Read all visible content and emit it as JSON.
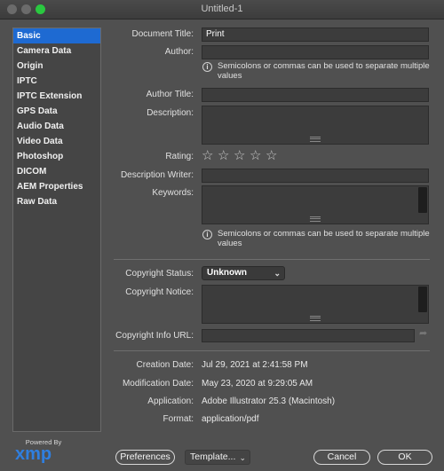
{
  "window": {
    "title": "Untitled-1"
  },
  "sidebar": {
    "items": [
      {
        "label": "Basic",
        "selected": true
      },
      {
        "label": "Camera Data"
      },
      {
        "label": "Origin"
      },
      {
        "label": "IPTC"
      },
      {
        "label": "IPTC Extension"
      },
      {
        "label": "GPS Data"
      },
      {
        "label": "Audio Data"
      },
      {
        "label": "Video Data"
      },
      {
        "label": "Photoshop"
      },
      {
        "label": "DICOM"
      },
      {
        "label": "AEM Properties"
      },
      {
        "label": "Raw Data"
      }
    ]
  },
  "form": {
    "document_title": {
      "label": "Document Title:",
      "value": "Print"
    },
    "author": {
      "label": "Author:",
      "value": ""
    },
    "author_info": "Semicolons or commas can be used to separate multiple values",
    "author_title": {
      "label": "Author Title:",
      "value": ""
    },
    "description": {
      "label": "Description:",
      "value": ""
    },
    "rating": {
      "label": "Rating:",
      "stars": 5,
      "value": 0,
      "glyph": "☆"
    },
    "description_writer": {
      "label": "Description Writer:",
      "value": ""
    },
    "keywords": {
      "label": "Keywords:",
      "value": ""
    },
    "keywords_info": "Semicolons or commas can be used to separate multiple values",
    "copyright_status": {
      "label": "Copyright Status:",
      "value": "Unknown"
    },
    "copyright_notice": {
      "label": "Copyright Notice:",
      "value": ""
    },
    "copyright_url": {
      "label": "Copyright Info URL:",
      "value": ""
    },
    "creation_date": {
      "label": "Creation Date:",
      "value": "Jul 29, 2021 at 2:41:58 PM"
    },
    "modification_date": {
      "label": "Modification Date:",
      "value": "May 23, 2020 at 9:29:05 AM"
    },
    "application": {
      "label": "Application:",
      "value": "Adobe Illustrator 25.3 (Macintosh)"
    },
    "format": {
      "label": "Format:",
      "value": "application/pdf"
    }
  },
  "footer": {
    "powered_by": "Powered By",
    "logo_text": "xmp",
    "preferences": "Preferences",
    "template": "Template...",
    "cancel": "Cancel",
    "ok": "OK"
  },
  "icons": {
    "info": "info-icon",
    "dropdown": "chevron-down-icon",
    "go": "arrow-right-icon"
  },
  "colors": {
    "selection": "#1e6ad2",
    "background": "#505050",
    "logo": "#2f7fe0"
  }
}
